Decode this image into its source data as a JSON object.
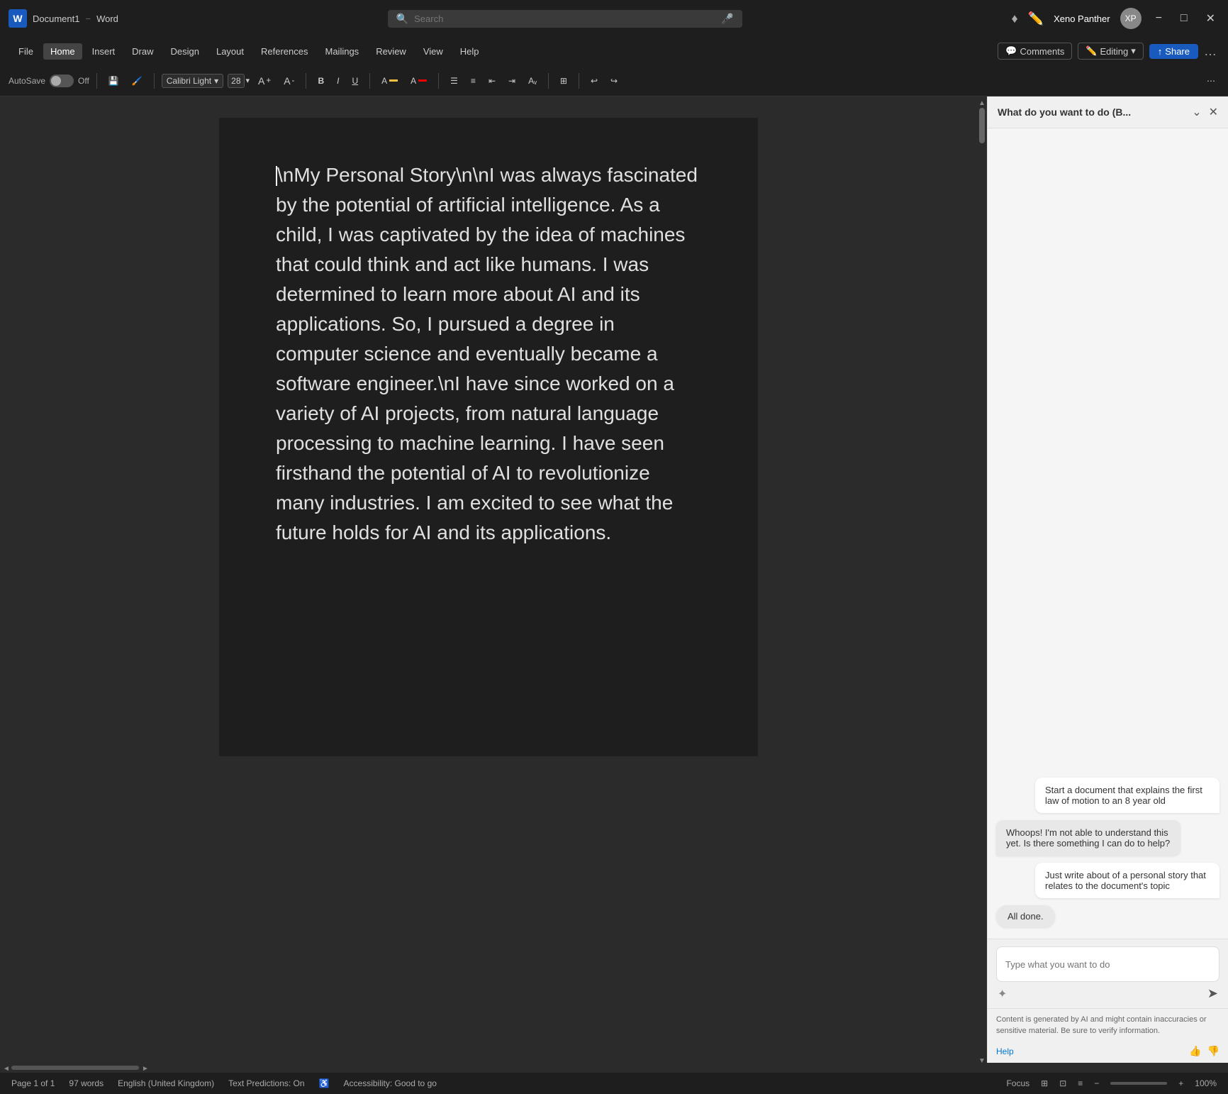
{
  "titlebar": {
    "app_name": "Word",
    "doc_name": "Document1",
    "search_placeholder": "Search",
    "user_name": "Xeno Panther",
    "avatar_initials": "XP",
    "min_label": "−",
    "max_label": "□",
    "close_label": "✕"
  },
  "menubar": {
    "items": [
      "File",
      "Home",
      "Insert",
      "Draw",
      "Design",
      "Layout",
      "References",
      "Mailings",
      "Review",
      "View",
      "Help"
    ],
    "comments_label": "Comments",
    "editing_label": "Editing",
    "share_label": "Share"
  },
  "toolbar": {
    "autosave_label": "AutoSave",
    "toggle_label": "Off",
    "font_name": "Calibri Light",
    "font_size": "28",
    "bold": "B",
    "italic": "I",
    "underline": "U"
  },
  "document": {
    "content": "\\nMy Personal Story\\n\\nI was always fascinated by the potential of artificial intelligence. As a child, I was captivated by the idea of machines that could think and act like humans. I was determined to learn more about AI and its applications. So, I pursued a degree in computer science and eventually became a software engineer.\\nI have since worked on a variety of AI projects, from natural language processing to machine learning. I have seen firsthand the potential of AI to revolutionize many industries. I am excited to see what the future holds for AI and its applications."
  },
  "side_panel": {
    "title": "What do you want to do (B...",
    "chat_messages": [
      {
        "type": "right",
        "text": "Start a document that explains the first law of motion to an 8 year old"
      },
      {
        "type": "left",
        "text": "Whoops! I'm not able to understand this yet. Is there something I can do to help?"
      },
      {
        "type": "right",
        "text": "Just write about of a personal story that relates to the document's topic"
      },
      {
        "type": "left_small",
        "text": "All done."
      }
    ],
    "input_placeholder": "Type what you want to do",
    "disclaimer_text": "Content is generated by AI and might contain inaccuracies or sensitive material. Be sure to verify information.",
    "help_label": "Help"
  },
  "statusbar": {
    "page_info": "Page 1 of 1",
    "word_count": "97 words",
    "language": "English (United Kingdom)",
    "text_predictions": "Text Predictions: On",
    "accessibility": "Accessibility: Good to go",
    "focus_label": "Focus",
    "zoom_level": "100%"
  }
}
